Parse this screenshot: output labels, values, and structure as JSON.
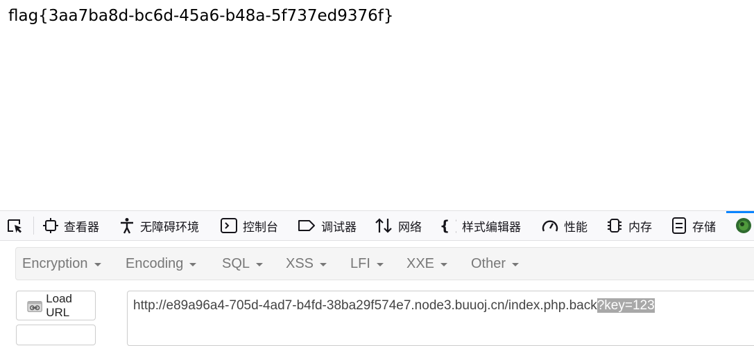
{
  "page": {
    "flag_text": "flag{3aa7ba8d-bc6d-45a6-b48a-5f737ed9376f}"
  },
  "devtools": {
    "tabs": [
      {
        "label": "查看器",
        "icon": "inspector-icon"
      },
      {
        "label": "无障碍环境",
        "icon": "accessibility-icon"
      },
      {
        "label": "控制台",
        "icon": "console-icon"
      },
      {
        "label": "调试器",
        "icon": "debugger-icon"
      },
      {
        "label": "网络",
        "icon": "network-icon"
      },
      {
        "label": "样式编辑器",
        "icon": "style-editor-icon"
      },
      {
        "label": "性能",
        "icon": "performance-icon"
      },
      {
        "label": "内存",
        "icon": "memory-icon"
      },
      {
        "label": "存储",
        "icon": "storage-icon"
      }
    ],
    "accent_color": "#0a84ff"
  },
  "hackbar": {
    "menu": [
      "Encryption",
      "Encoding",
      "SQL",
      "XSS",
      "LFI",
      "XXE",
      "Other"
    ],
    "load_url_label": "Load URL",
    "url_main": "http://e89a96a4-705d-4ad7-b4fd-38ba29f574e7.node3.buuoj.cn/index.php.back",
    "url_selected": "?key=123"
  }
}
